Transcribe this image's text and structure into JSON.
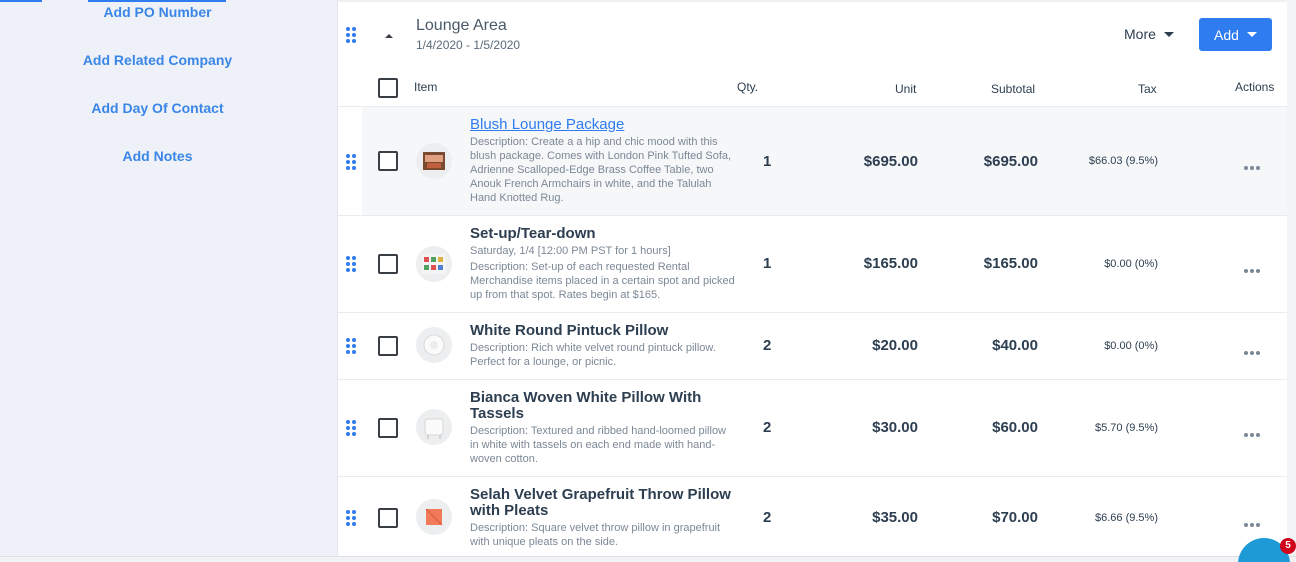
{
  "sidebar": {
    "links": [
      "Add PO Number",
      "Add Related Company",
      "Add Day Of Contact",
      "Add Notes"
    ]
  },
  "section": {
    "title": "Lounge Area",
    "dates": "1/4/2020 - 1/5/2020",
    "more_label": "More",
    "add_label": "Add"
  },
  "columns": {
    "item": "Item",
    "qty": "Qty.",
    "unit": "Unit",
    "subtotal": "Subtotal",
    "tax": "Tax",
    "actions": "Actions"
  },
  "rows": [
    {
      "name": "Blush Lounge Package",
      "sub": "Description: Create a a hip and chic mood with this blush package. Comes with London Pink Tufted Sofa, Adrienne Scalloped-Edge Brass Coffee Table, two Anouk French Armchairs in white, and the Talulah Hand Knotted Rug.",
      "qty": "1",
      "unit": "$695.00",
      "subtotal": "$695.00",
      "tax": "$66.03 (9.5%)"
    },
    {
      "name": "Set-up/Tear-down",
      "sub_line1": "Saturday, 1/4  [12:00 PM PST for 1 hours]",
      "sub": "Description: Set-up of each requested Rental Merchandise items placed in a certain spot and picked up from that spot. Rates begin at $165.",
      "qty": "1",
      "unit": "$165.00",
      "subtotal": "$165.00",
      "tax": "$0.00 (0%)"
    },
    {
      "name": "White Round Pintuck Pillow",
      "sub": "Description: Rich white velvet round pintuck pillow. Perfect for a lounge, or picnic.",
      "qty": "2",
      "unit": "$20.00",
      "subtotal": "$40.00",
      "tax": "$0.00 (0%)"
    },
    {
      "name": "Bianca Woven White Pillow With Tassels",
      "sub": "Description: Textured and ribbed hand-loomed pillow in white with tassels on each end made with hand-woven cotton.",
      "qty": "2",
      "unit": "$30.00",
      "subtotal": "$60.00",
      "tax": "$5.70 (9.5%)"
    },
    {
      "name": "Selah Velvet Grapefruit Throw Pillow with Pleats",
      "sub": "Description: Square velvet throw pillow in grapefruit with unique pleats on the side.",
      "qty": "2",
      "unit": "$35.00",
      "subtotal": "$70.00",
      "tax": "$6.66 (9.5%)"
    }
  ],
  "chat": {
    "badge": "5"
  },
  "colors": {
    "accent": "#2f7bf0",
    "sidebar_bg": "#eef1f7",
    "chat": "#1e9ad6",
    "badge": "#d0021b"
  }
}
